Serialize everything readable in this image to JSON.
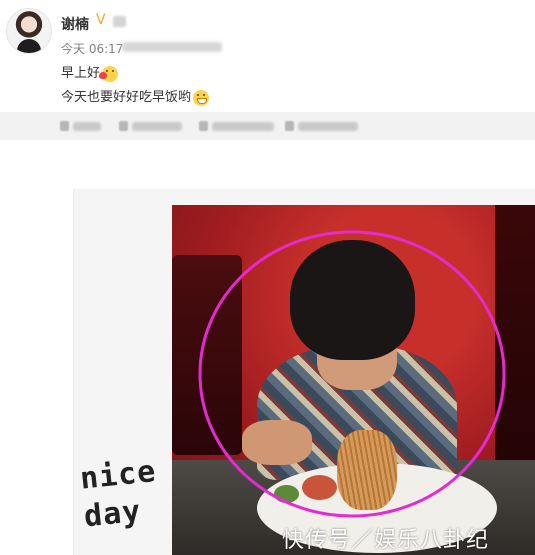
{
  "post": {
    "author": "谢楠",
    "time": "今天 06:17",
    "content_line1": "早上好",
    "content_line2": "今天也要好好吃早饭哟"
  },
  "image": {
    "handwriting_line1": "nice",
    "handwriting_line2": "day",
    "watermark": "快传号／娱乐八卦纪"
  },
  "colors": {
    "verified": "#f5a623",
    "circle": "#e42ad2",
    "action_bar_bg": "#f2f2f2"
  },
  "icons": {
    "verified": "v-badge-icon",
    "emoji_line1": "kiss-heart-emoji-icon",
    "emoji_line2": "grin-emoji-icon"
  }
}
